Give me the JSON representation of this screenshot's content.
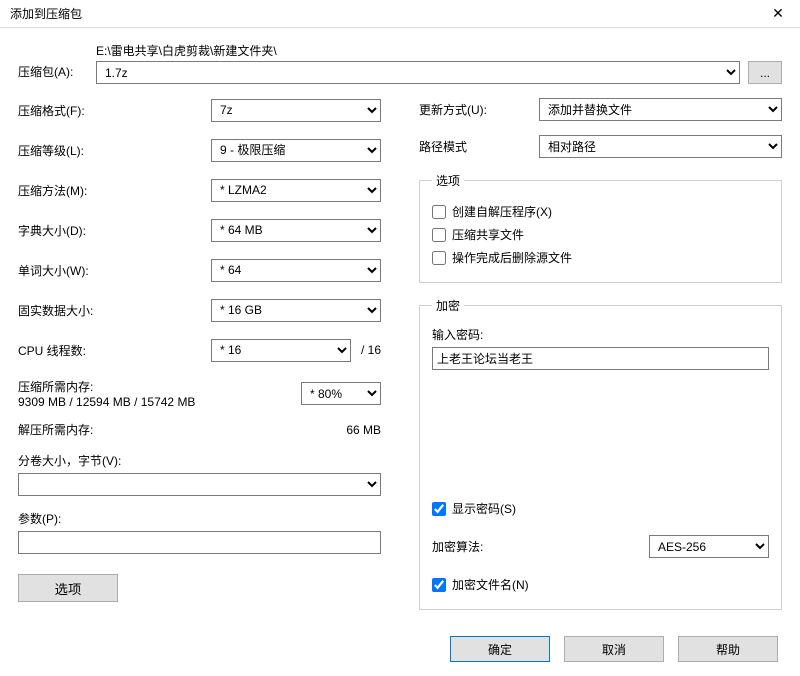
{
  "window": {
    "title": "添加到压缩包"
  },
  "archive": {
    "label": "压缩包(A):",
    "path": "E:\\雷电共享\\白虎剪裁\\新建文件夹\\",
    "file": "1.7z",
    "browse": "..."
  },
  "left": {
    "format_label": "压缩格式(F):",
    "format_value": "7z",
    "level_label": "压缩等级(L):",
    "level_value": "9 - 极限压缩",
    "method_label": "压缩方法(M):",
    "method_value": "* LZMA2",
    "dict_label": "字典大小(D):",
    "dict_value": "* 64 MB",
    "word_label": "单词大小(W):",
    "word_value": "* 64",
    "solid_label": "固实数据大小:",
    "solid_value": "* 16 GB",
    "threads_label": "CPU 线程数:",
    "threads_value": "* 16",
    "threads_total": "/ 16",
    "mem_comp_label": "压缩所需内存:",
    "mem_comp_value": "9309 MB / 12594 MB / 15742 MB",
    "mem_pct_value": "* 80%",
    "mem_decomp_label": "解压所需内存:",
    "mem_decomp_value": "66 MB",
    "split_label": "分卷大小，字节(V):",
    "params_label": "参数(P):",
    "options_btn": "选项"
  },
  "right": {
    "update_label": "更新方式(U):",
    "update_value": "添加并替换文件",
    "pathmode_label": "路径模式",
    "pathmode_value": "相对路径",
    "options_legend": "选项",
    "opt_sfx": "创建自解压程序(X)",
    "opt_share": "压缩共享文件",
    "opt_delete": "操作完成后删除源文件",
    "encrypt_legend": "加密",
    "pwd_label": "输入密码:",
    "pwd_value": "上老王论坛当老王",
    "show_pwd": "显示密码(S)",
    "algo_label": "加密算法:",
    "algo_value": "AES-256",
    "enc_names": "加密文件名(N)"
  },
  "footer": {
    "ok": "确定",
    "cancel": "取消",
    "help": "帮助"
  }
}
